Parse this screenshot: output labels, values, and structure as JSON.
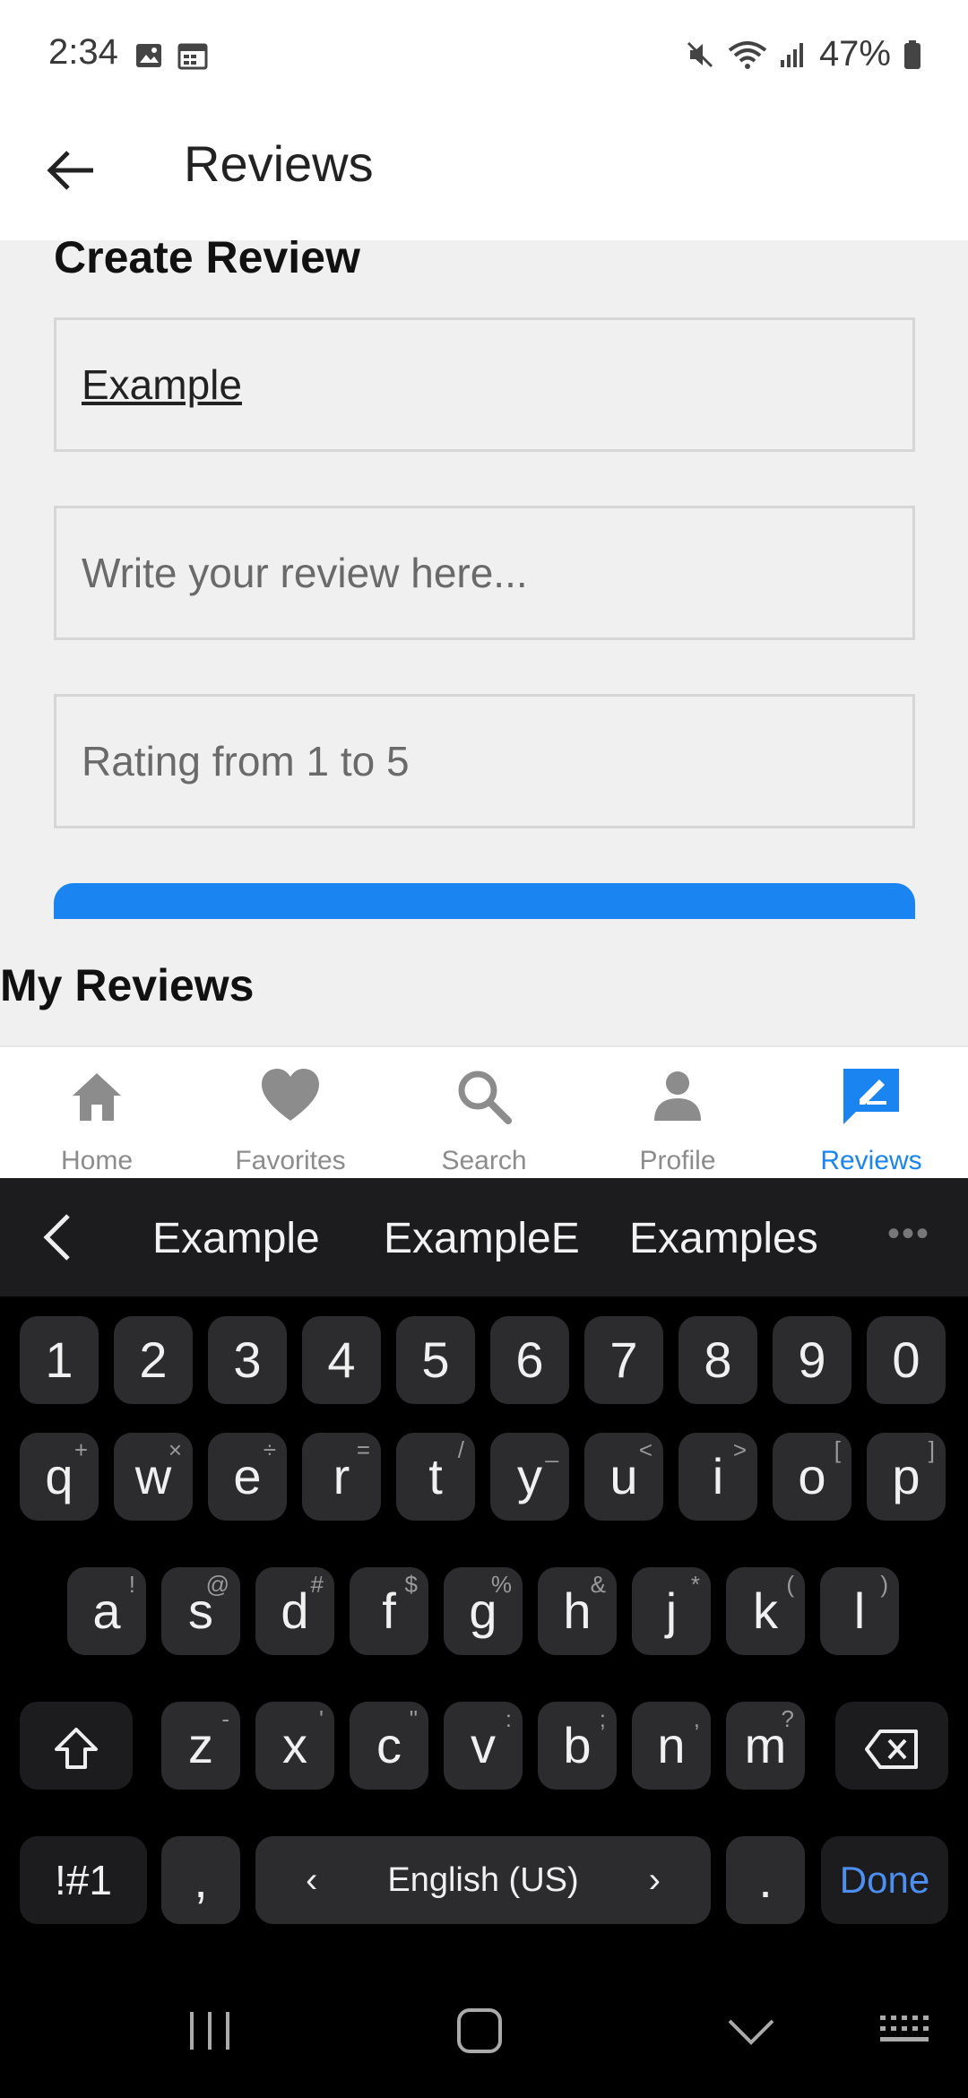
{
  "status": {
    "time": "2:34",
    "battery": "47%"
  },
  "appbar": {
    "title": "Reviews"
  },
  "create": {
    "heading": "Create Review",
    "name_value": "Example",
    "review_placeholder": "Write your review here...",
    "rating_placeholder": "Rating from 1 to 5"
  },
  "my_reviews": {
    "heading": "My Reviews"
  },
  "bottom_nav": {
    "items": [
      {
        "label": "Home",
        "icon": "home-icon"
      },
      {
        "label": "Favorites",
        "icon": "heart-icon"
      },
      {
        "label": "Search",
        "icon": "search-icon"
      },
      {
        "label": "Profile",
        "icon": "person-icon"
      },
      {
        "label": "Reviews",
        "icon": "reviews-icon",
        "active": true
      }
    ],
    "active_color": "#1a84f0"
  },
  "keyboard": {
    "suggestions": [
      "Example",
      "ExampleE",
      "Examples"
    ],
    "number_row": [
      "1",
      "2",
      "3",
      "4",
      "5",
      "6",
      "7",
      "8",
      "9",
      "0"
    ],
    "row1": [
      {
        "k": "q",
        "s": "+"
      },
      {
        "k": "w",
        "s": "×"
      },
      {
        "k": "e",
        "s": "÷"
      },
      {
        "k": "r",
        "s": "="
      },
      {
        "k": "t",
        "s": "/"
      },
      {
        "k": "y",
        "s": "_"
      },
      {
        "k": "u",
        "s": "<"
      },
      {
        "k": "i",
        "s": ">"
      },
      {
        "k": "o",
        "s": "["
      },
      {
        "k": "p",
        "s": "]"
      }
    ],
    "row2": [
      {
        "k": "a",
        "s": "!"
      },
      {
        "k": "s",
        "s": "@"
      },
      {
        "k": "d",
        "s": "#"
      },
      {
        "k": "f",
        "s": "$"
      },
      {
        "k": "g",
        "s": "%"
      },
      {
        "k": "h",
        "s": "&"
      },
      {
        "k": "j",
        "s": "*"
      },
      {
        "k": "k",
        "s": "("
      },
      {
        "k": "l",
        "s": ")"
      }
    ],
    "row3": [
      {
        "k": "z",
        "s": "-"
      },
      {
        "k": "x",
        "s": "'"
      },
      {
        "k": "c",
        "s": "\""
      },
      {
        "k": "v",
        "s": ":"
      },
      {
        "k": "b",
        "s": ";"
      },
      {
        "k": "n",
        "s": ","
      },
      {
        "k": "m",
        "s": "?"
      }
    ],
    "symbols_label": "!#1",
    "comma": ",",
    "language": "English (US)",
    "period": ".",
    "done": "Done"
  }
}
